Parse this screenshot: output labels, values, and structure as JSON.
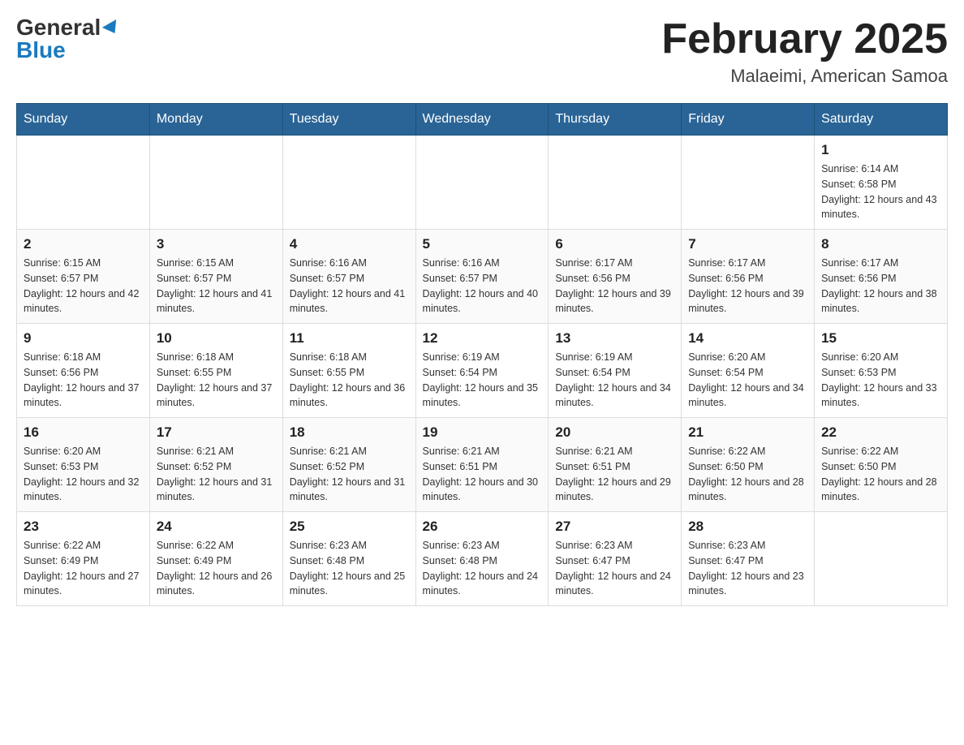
{
  "logo": {
    "general": "General",
    "blue": "Blue"
  },
  "title": "February 2025",
  "subtitle": "Malaeimi, American Samoa",
  "days_of_week": [
    "Sunday",
    "Monday",
    "Tuesday",
    "Wednesday",
    "Thursday",
    "Friday",
    "Saturday"
  ],
  "weeks": [
    [
      {
        "day": "",
        "info": ""
      },
      {
        "day": "",
        "info": ""
      },
      {
        "day": "",
        "info": ""
      },
      {
        "day": "",
        "info": ""
      },
      {
        "day": "",
        "info": ""
      },
      {
        "day": "",
        "info": ""
      },
      {
        "day": "1",
        "info": "Sunrise: 6:14 AM\nSunset: 6:58 PM\nDaylight: 12 hours and 43 minutes."
      }
    ],
    [
      {
        "day": "2",
        "info": "Sunrise: 6:15 AM\nSunset: 6:57 PM\nDaylight: 12 hours and 42 minutes."
      },
      {
        "day": "3",
        "info": "Sunrise: 6:15 AM\nSunset: 6:57 PM\nDaylight: 12 hours and 41 minutes."
      },
      {
        "day": "4",
        "info": "Sunrise: 6:16 AM\nSunset: 6:57 PM\nDaylight: 12 hours and 41 minutes."
      },
      {
        "day": "5",
        "info": "Sunrise: 6:16 AM\nSunset: 6:57 PM\nDaylight: 12 hours and 40 minutes."
      },
      {
        "day": "6",
        "info": "Sunrise: 6:17 AM\nSunset: 6:56 PM\nDaylight: 12 hours and 39 minutes."
      },
      {
        "day": "7",
        "info": "Sunrise: 6:17 AM\nSunset: 6:56 PM\nDaylight: 12 hours and 39 minutes."
      },
      {
        "day": "8",
        "info": "Sunrise: 6:17 AM\nSunset: 6:56 PM\nDaylight: 12 hours and 38 minutes."
      }
    ],
    [
      {
        "day": "9",
        "info": "Sunrise: 6:18 AM\nSunset: 6:56 PM\nDaylight: 12 hours and 37 minutes."
      },
      {
        "day": "10",
        "info": "Sunrise: 6:18 AM\nSunset: 6:55 PM\nDaylight: 12 hours and 37 minutes."
      },
      {
        "day": "11",
        "info": "Sunrise: 6:18 AM\nSunset: 6:55 PM\nDaylight: 12 hours and 36 minutes."
      },
      {
        "day": "12",
        "info": "Sunrise: 6:19 AM\nSunset: 6:54 PM\nDaylight: 12 hours and 35 minutes."
      },
      {
        "day": "13",
        "info": "Sunrise: 6:19 AM\nSunset: 6:54 PM\nDaylight: 12 hours and 34 minutes."
      },
      {
        "day": "14",
        "info": "Sunrise: 6:20 AM\nSunset: 6:54 PM\nDaylight: 12 hours and 34 minutes."
      },
      {
        "day": "15",
        "info": "Sunrise: 6:20 AM\nSunset: 6:53 PM\nDaylight: 12 hours and 33 minutes."
      }
    ],
    [
      {
        "day": "16",
        "info": "Sunrise: 6:20 AM\nSunset: 6:53 PM\nDaylight: 12 hours and 32 minutes."
      },
      {
        "day": "17",
        "info": "Sunrise: 6:21 AM\nSunset: 6:52 PM\nDaylight: 12 hours and 31 minutes."
      },
      {
        "day": "18",
        "info": "Sunrise: 6:21 AM\nSunset: 6:52 PM\nDaylight: 12 hours and 31 minutes."
      },
      {
        "day": "19",
        "info": "Sunrise: 6:21 AM\nSunset: 6:51 PM\nDaylight: 12 hours and 30 minutes."
      },
      {
        "day": "20",
        "info": "Sunrise: 6:21 AM\nSunset: 6:51 PM\nDaylight: 12 hours and 29 minutes."
      },
      {
        "day": "21",
        "info": "Sunrise: 6:22 AM\nSunset: 6:50 PM\nDaylight: 12 hours and 28 minutes."
      },
      {
        "day": "22",
        "info": "Sunrise: 6:22 AM\nSunset: 6:50 PM\nDaylight: 12 hours and 28 minutes."
      }
    ],
    [
      {
        "day": "23",
        "info": "Sunrise: 6:22 AM\nSunset: 6:49 PM\nDaylight: 12 hours and 27 minutes."
      },
      {
        "day": "24",
        "info": "Sunrise: 6:22 AM\nSunset: 6:49 PM\nDaylight: 12 hours and 26 minutes."
      },
      {
        "day": "25",
        "info": "Sunrise: 6:23 AM\nSunset: 6:48 PM\nDaylight: 12 hours and 25 minutes."
      },
      {
        "day": "26",
        "info": "Sunrise: 6:23 AM\nSunset: 6:48 PM\nDaylight: 12 hours and 24 minutes."
      },
      {
        "day": "27",
        "info": "Sunrise: 6:23 AM\nSunset: 6:47 PM\nDaylight: 12 hours and 24 minutes."
      },
      {
        "day": "28",
        "info": "Sunrise: 6:23 AM\nSunset: 6:47 PM\nDaylight: 12 hours and 23 minutes."
      },
      {
        "day": "",
        "info": ""
      }
    ]
  ]
}
